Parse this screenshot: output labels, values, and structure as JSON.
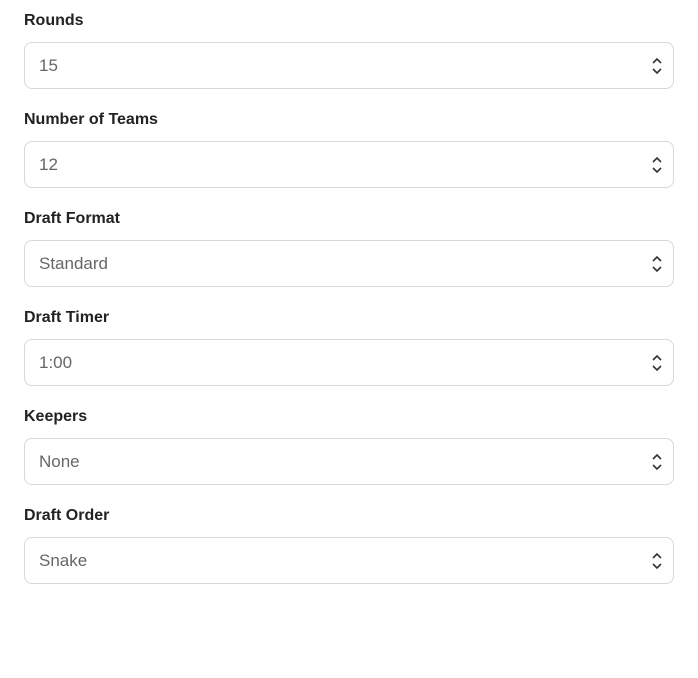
{
  "fields": {
    "rounds": {
      "label": "Rounds",
      "value": "15"
    },
    "numberOfTeams": {
      "label": "Number of Teams",
      "value": "12"
    },
    "draftFormat": {
      "label": "Draft Format",
      "value": "Standard"
    },
    "draftTimer": {
      "label": "Draft Timer",
      "value": "1:00"
    },
    "keepers": {
      "label": "Keepers",
      "value": "None"
    },
    "draftOrder": {
      "label": "Draft Order",
      "value": "Snake"
    }
  }
}
